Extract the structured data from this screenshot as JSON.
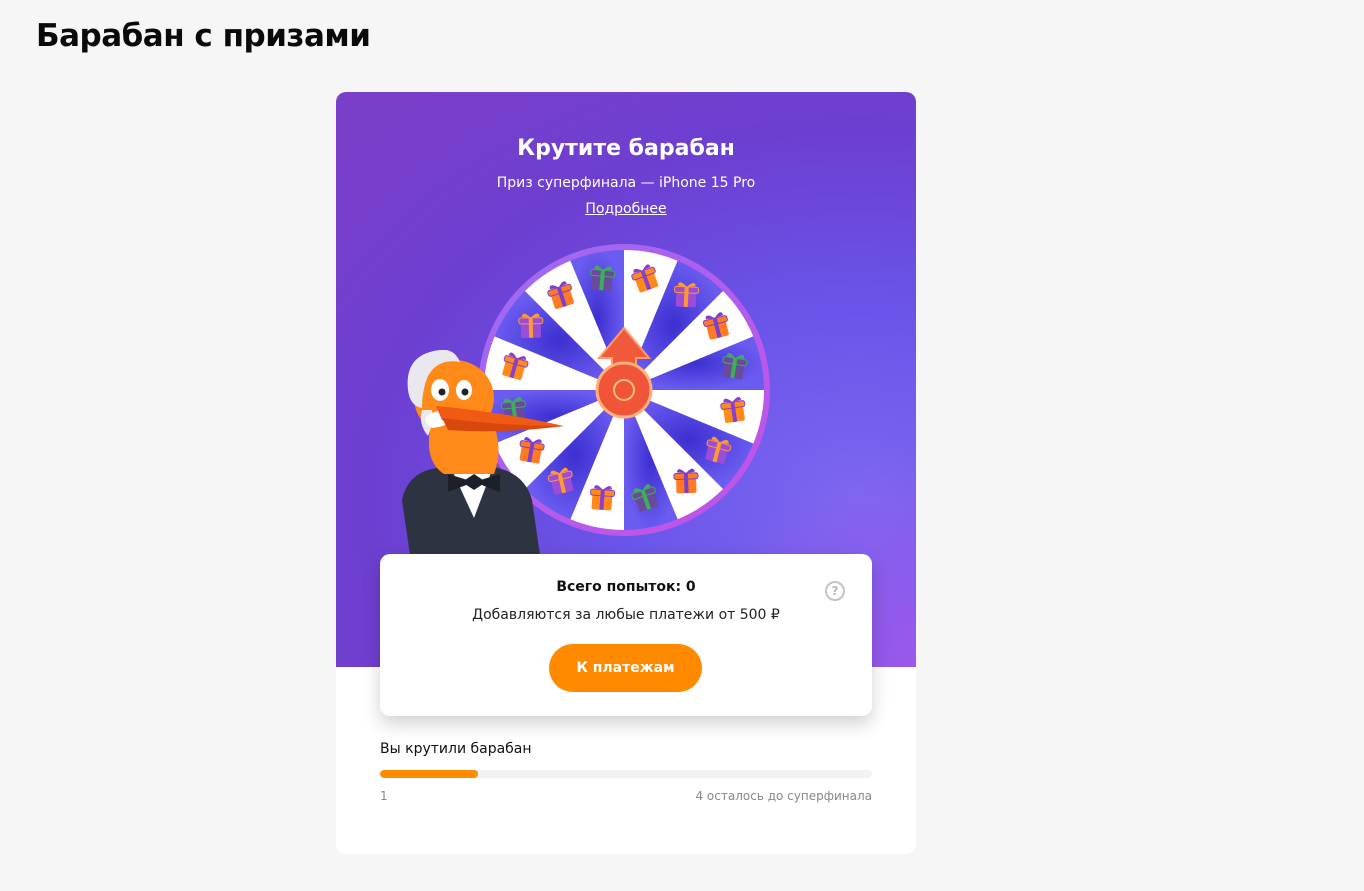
{
  "page": {
    "title": "Барабан с призами"
  },
  "hero": {
    "title": "Крутите барабан",
    "subtitle": "Приз суперфинала — iPhone 15 Pro",
    "details_link": "Подробнее"
  },
  "attempts": {
    "title": "Всего попыток: 0",
    "note": "Добавляются за любые платежи от 500 ₽",
    "button_label": "К платежам",
    "help_icon": "question-circle-icon"
  },
  "progress": {
    "label": "Вы крутили барабан",
    "spins": "1",
    "remaining_text": "4 осталось до суперфинала",
    "fraction": 0.2
  },
  "colors": {
    "accent": "#ff8a00",
    "hero_purple": "#6a55ea",
    "wheel_blue": "#5b4be0",
    "arrow_red": "#f0553a"
  }
}
